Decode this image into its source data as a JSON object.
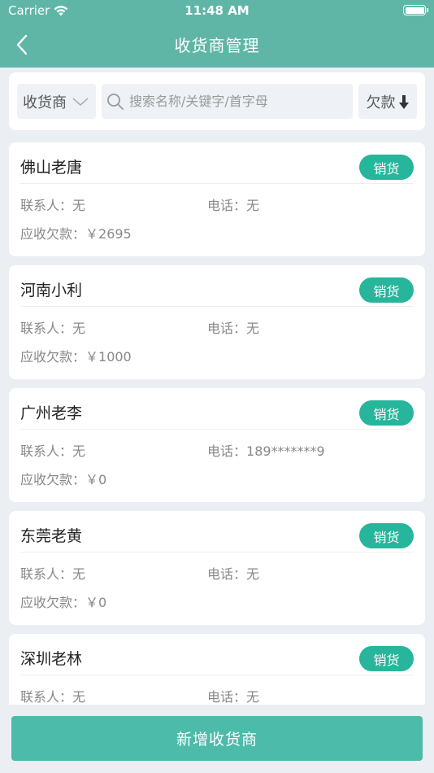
{
  "status_bar": {
    "carrier": "Carrier",
    "time": "11:48 AM"
  },
  "nav": {
    "title": "收货商管理"
  },
  "search": {
    "type_label": "收货商",
    "placeholder": "搜索名称/关键字/首字母",
    "sort_label": "欠款"
  },
  "labels": {
    "contact": "联系人：",
    "phone": "电话：",
    "debt": "应收欠款：",
    "sale": "销货"
  },
  "receivers": [
    {
      "name": "佛山老唐",
      "contact": "无",
      "phone": "无",
      "debt": "￥2695"
    },
    {
      "name": "河南小利",
      "contact": "无",
      "phone": "无",
      "debt": "￥1000"
    },
    {
      "name": "广州老李",
      "contact": "无",
      "phone": "189*******9",
      "debt": "￥0"
    },
    {
      "name": "东莞老黄",
      "contact": "无",
      "phone": "无",
      "debt": "￥0"
    },
    {
      "name": "深圳老林",
      "contact": "无",
      "phone": "无",
      "debt": ""
    }
  ],
  "footer": {
    "add_label": "新增收货商"
  },
  "colors": {
    "header": "#5fb6a6",
    "accent": "#27b59b",
    "add_button": "#4cbba9"
  }
}
